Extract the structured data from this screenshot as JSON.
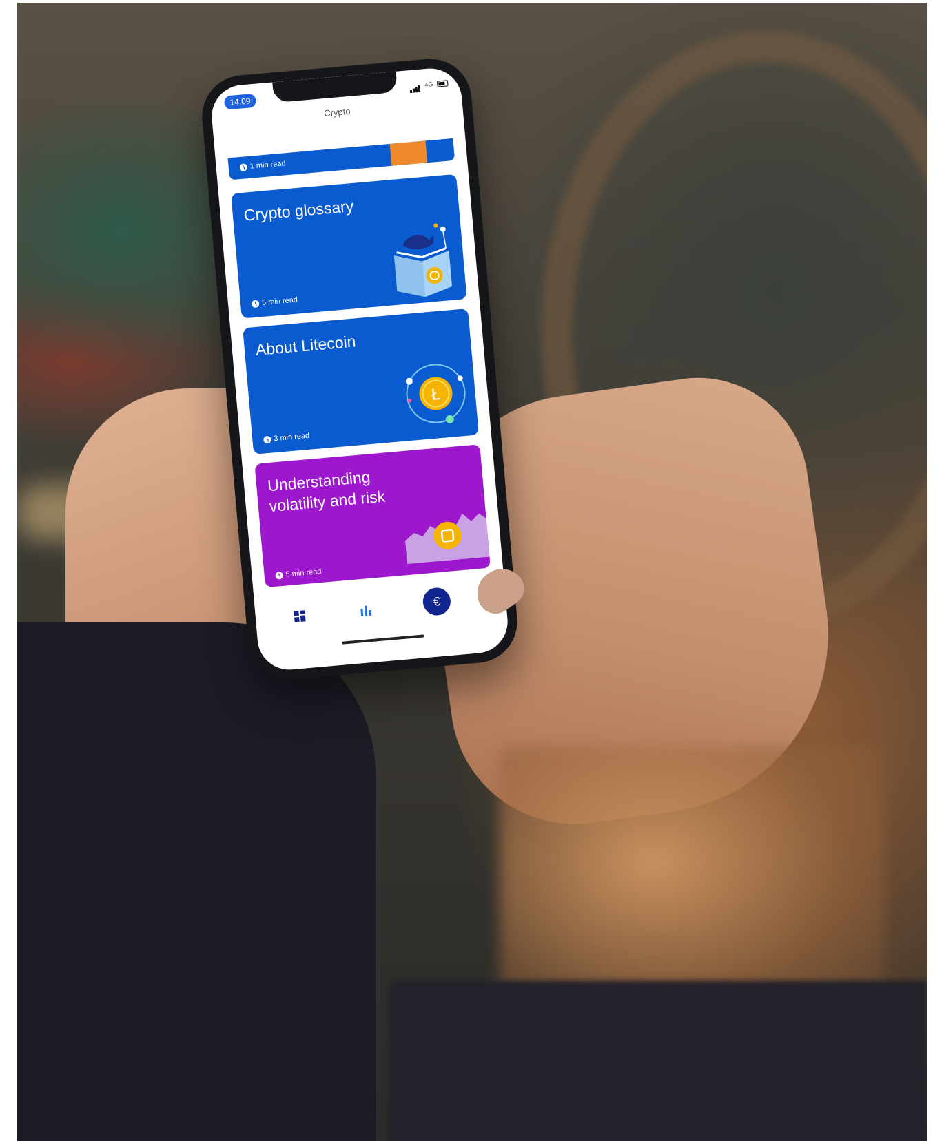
{
  "status_bar": {
    "time": "14:09",
    "network": "4G"
  },
  "screen": {
    "title": "Crypto"
  },
  "cards": [
    {
      "title": "",
      "read_time": "1 min read",
      "color": "#0a5bd0"
    },
    {
      "title": "Crypto glossary",
      "read_time": "5 min read",
      "color": "#0a5bd0",
      "icon": "book-icon"
    },
    {
      "title": "About Litecoin",
      "read_time": "3 min read",
      "color": "#0a5bd0",
      "icon": "litecoin-icon"
    },
    {
      "title": "Understanding volatility and risk",
      "read_time": "5 min read",
      "color": "#9d17cc",
      "icon": "chart-coin-icon"
    }
  ],
  "bottom_nav": {
    "items": [
      {
        "icon": "dashboard-icon"
      },
      {
        "icon": "bar-chart-icon"
      },
      {
        "icon": "euro-icon",
        "label": "€"
      },
      {
        "icon": "card-icon"
      }
    ]
  }
}
